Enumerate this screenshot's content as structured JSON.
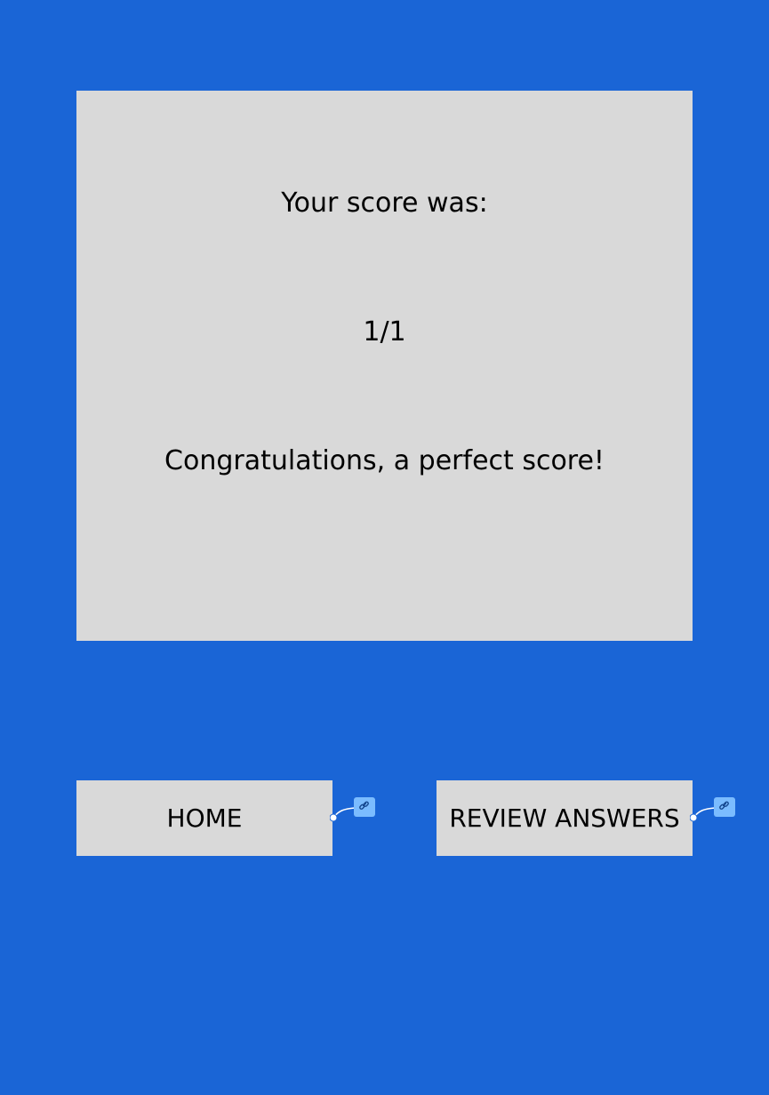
{
  "score_card": {
    "heading": "Your score was:",
    "score": "1/1",
    "message": "Congratulations, a perfect score!"
  },
  "actions": {
    "home_label": "HOME",
    "review_label": "REVIEW ANSWERS"
  },
  "colors": {
    "background": "#1a65d6",
    "card": "#d9d9d9",
    "text": "#000000",
    "link_badge": "#7bbcff"
  },
  "icons": {
    "prototype_link": "link-icon"
  }
}
